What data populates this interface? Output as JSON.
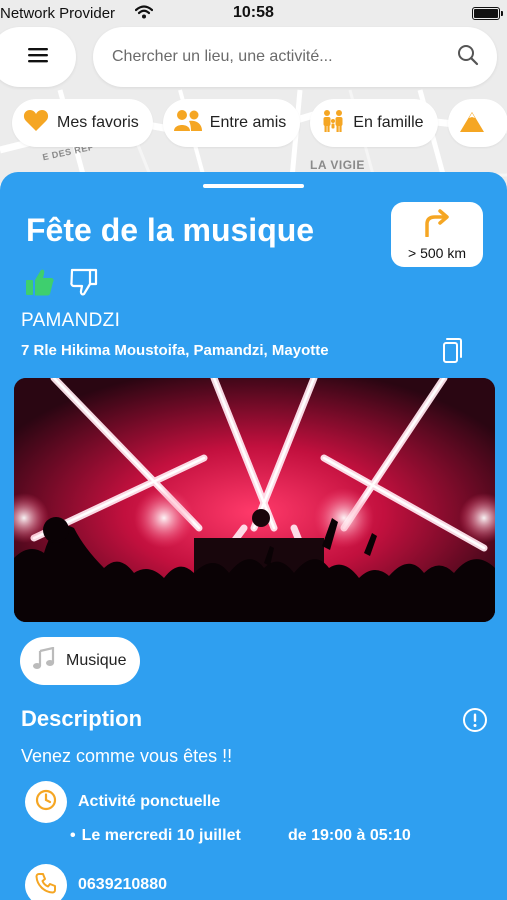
{
  "status_bar": {
    "carrier": "Network Provider",
    "time": "10:58"
  },
  "search": {
    "placeholder": "Chercher un lieu, une activité..."
  },
  "map": {
    "labels": [
      "LA VIGIE",
      "E DES REP"
    ]
  },
  "chips": [
    {
      "label": "Mes favoris",
      "icon": "heart-icon"
    },
    {
      "label": "Entre amis",
      "icon": "friends-icon"
    },
    {
      "label": "En famille",
      "icon": "family-icon"
    }
  ],
  "event": {
    "title": "Fête de la musique",
    "distance": "> 500 km",
    "city": "PAMANDZI",
    "address": "7 Rle Hikima Moustoifa, Pamandzi, Mayotte",
    "category": "Musique",
    "description_title": "Description",
    "description": "Venez comme vous êtes !!",
    "activity_type": "Activité ponctuelle",
    "date": "Le mercredi 10 juillet",
    "hours": "de 19:00 à 05:10",
    "phone": "0639210880"
  },
  "colors": {
    "sheet": "#2f9ff0",
    "accent_orange": "#f5a623",
    "thumb_up_green": "#3ecf6e"
  }
}
